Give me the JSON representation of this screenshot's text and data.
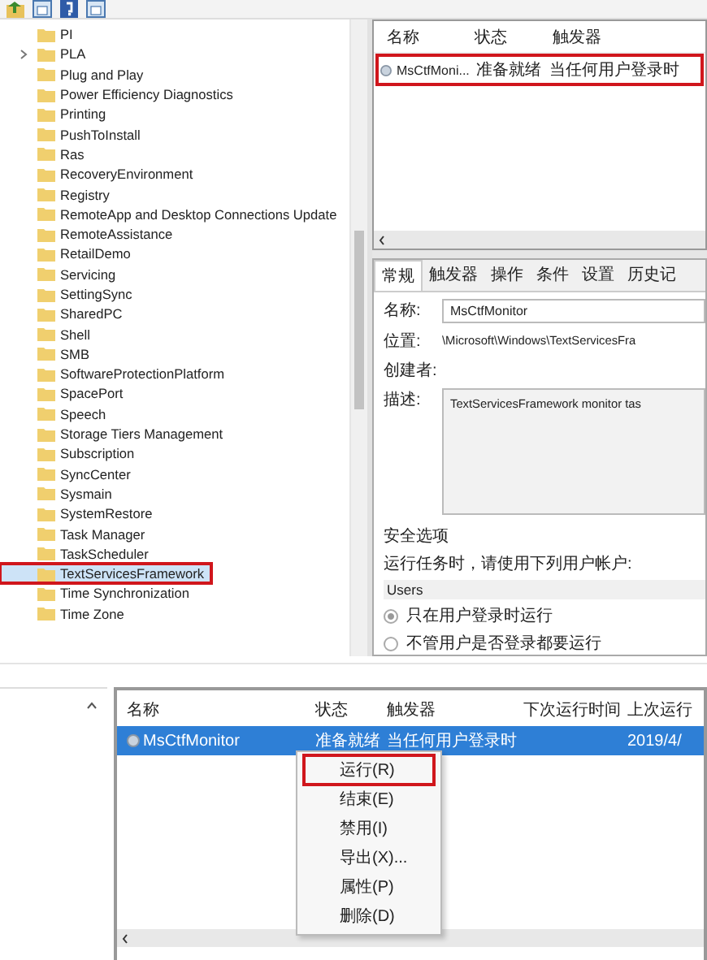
{
  "toolbar": {
    "buttons": [
      {
        "kind": "up"
      },
      {
        "kind": "panel"
      },
      {
        "kind": "help"
      },
      {
        "kind": "panel"
      }
    ]
  },
  "tree": {
    "items": [
      {
        "label": "PI",
        "expandable": false,
        "selected": false
      },
      {
        "label": "PLA",
        "expandable": true,
        "selected": false
      },
      {
        "label": "Plug and Play",
        "expandable": false,
        "selected": false
      },
      {
        "label": "Power Efficiency Diagnostics",
        "expandable": false,
        "selected": false
      },
      {
        "label": "Printing",
        "expandable": false,
        "selected": false
      },
      {
        "label": "PushToInstall",
        "expandable": false,
        "selected": false
      },
      {
        "label": "Ras",
        "expandable": false,
        "selected": false
      },
      {
        "label": "RecoveryEnvironment",
        "expandable": false,
        "selected": false
      },
      {
        "label": "Registry",
        "expandable": false,
        "selected": false
      },
      {
        "label": "RemoteApp and Desktop Connections Update",
        "expandable": false,
        "selected": false
      },
      {
        "label": "RemoteAssistance",
        "expandable": false,
        "selected": false
      },
      {
        "label": "RetailDemo",
        "expandable": false,
        "selected": false
      },
      {
        "label": "Servicing",
        "expandable": false,
        "selected": false
      },
      {
        "label": "SettingSync",
        "expandable": false,
        "selected": false
      },
      {
        "label": "SharedPC",
        "expandable": false,
        "selected": false
      },
      {
        "label": "Shell",
        "expandable": false,
        "selected": false
      },
      {
        "label": "SMB",
        "expandable": false,
        "selected": false
      },
      {
        "label": "SoftwareProtectionPlatform",
        "expandable": false,
        "selected": false
      },
      {
        "label": "SpacePort",
        "expandable": false,
        "selected": false
      },
      {
        "label": "Speech",
        "expandable": false,
        "selected": false
      },
      {
        "label": "Storage Tiers Management",
        "expandable": false,
        "selected": false
      },
      {
        "label": "Subscription",
        "expandable": false,
        "selected": false
      },
      {
        "label": "SyncCenter",
        "expandable": false,
        "selected": false
      },
      {
        "label": "Sysmain",
        "expandable": false,
        "selected": false
      },
      {
        "label": "SystemRestore",
        "expandable": false,
        "selected": false
      },
      {
        "label": "Task Manager",
        "expandable": false,
        "selected": false
      },
      {
        "label": "TaskScheduler",
        "expandable": false,
        "selected": false
      },
      {
        "label": "TextServicesFramework",
        "expandable": false,
        "selected": true,
        "highlighted": true
      },
      {
        "label": "Time Synchronization",
        "expandable": false,
        "selected": false
      },
      {
        "label": "Time Zone",
        "expandable": false,
        "selected": false
      }
    ]
  },
  "task_list": {
    "columns": [
      "名称",
      "状态",
      "触发器"
    ],
    "rows": [
      {
        "cells": [
          "MsCtfMoni...",
          "准备就绪",
          "当任何用户登录时"
        ],
        "selected": false,
        "highlighted": true
      }
    ]
  },
  "details": {
    "tabs": [
      {
        "label": "常规",
        "selected": true
      },
      {
        "label": "触发器",
        "selected": false
      },
      {
        "label": "操作",
        "selected": false
      },
      {
        "label": "条件",
        "selected": false
      },
      {
        "label": "设置",
        "selected": false
      },
      {
        "label": "历史记",
        "selected": false
      }
    ],
    "fields": [
      {
        "label": "名称:",
        "value": "MsCtfMonitor",
        "kind": "input"
      },
      {
        "label": "位置:",
        "value": "\\Microsoft\\Windows\\TextServicesFra",
        "kind": "text"
      },
      {
        "label": "创建者:",
        "kind": "text"
      },
      {
        "label": "描述:",
        "value": "TextServicesFramework monitor tas",
        "kind": "textarea"
      }
    ],
    "security": {
      "title": "安全选项",
      "prompt": "运行任务时，请使用下列用户帐户:",
      "account": "Users",
      "options": [
        {
          "label": "只在用户登录时运行",
          "selected": true
        },
        {
          "label": "不管用户是否登录都要运行",
          "selected": false
        }
      ]
    }
  },
  "bottom_list": {
    "columns": [
      "名称",
      "状态",
      "触发器",
      "下次运行时间",
      "上次运行"
    ],
    "rows": [
      {
        "cells": [
          "MsCtfMonitor",
          "准备就绪",
          "当任何用户登录时",
          "",
          "2019/4/"
        ],
        "selected": true
      }
    ],
    "context_menu": [
      {
        "label": "运行(R)",
        "highlighted": true
      },
      {
        "label": "结束(E)",
        "highlighted": false
      },
      {
        "label": "禁用(I)",
        "highlighted": false
      },
      {
        "label": "导出(X)...",
        "highlighted": false
      },
      {
        "label": "属性(P)",
        "highlighted": false
      },
      {
        "label": "删除(D)",
        "highlighted": false
      }
    ]
  }
}
